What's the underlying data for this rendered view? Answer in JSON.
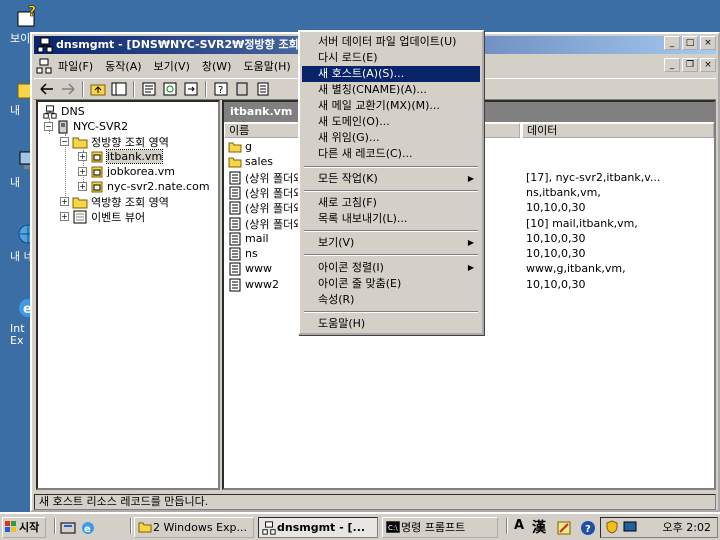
{
  "desktop": {
    "icons": [
      {
        "label": "보이"
      },
      {
        "label": "내"
      },
      {
        "label": "내"
      },
      {
        "label": "내 네"
      },
      {
        "label": "Int"
      },
      {
        "label": "Ex"
      }
    ]
  },
  "window": {
    "title": "dnsmgmt - [DNS₩NYC-SVR2₩정방향 조회",
    "menu": [
      "파일(F)",
      "동작(A)",
      "보기(V)",
      "창(W)",
      "도움말(H)"
    ]
  },
  "tree": {
    "root": "DNS",
    "server": "NYC-SVR2",
    "forward_zone": "정방향 조회 영역",
    "zones": [
      "itbank.vm",
      "jobkorea.vm",
      "nyc-svr2.nate.com"
    ],
    "reverse_zone": "역방향 조회 영역",
    "event_viewer": "이벤트 뷰어"
  },
  "details": {
    "zone_title": "itbank.vm",
    "col_name": "이름",
    "col_data": "데이터",
    "rows": [
      {
        "name": "g",
        "data": ""
      },
      {
        "name": "sales",
        "data": ""
      },
      {
        "name": "(상위 폴더와",
        "data": "[17], nyc-svr2,itbank,v..."
      },
      {
        "name": "(상위 폴더와",
        "data": "ns,itbank,vm,"
      },
      {
        "name": "(상위 폴더와",
        "data": "10,10,0,30"
      },
      {
        "name": "(상위 폴더와",
        "data": "[10]  mail,itbank,vm,"
      },
      {
        "name": "mail",
        "data": "10,10,0,30"
      },
      {
        "name": "ns",
        "data": "10,10,0,30"
      },
      {
        "name": "www",
        "data": "www,g,itbank,vm,"
      },
      {
        "name": "www2",
        "data": "10,10,0,30"
      }
    ]
  },
  "status": "새 호스트 리소스 레코드를 만듭니다.",
  "context_menu": {
    "items": [
      {
        "label": "서버 데이터 파일 업데이트(U)"
      },
      {
        "label": "다시 로드(E)"
      },
      {
        "label": "새 호스트(A)(S)..."
      },
      {
        "label": "새 별칭(CNAME)(A)..."
      },
      {
        "label": "새 메일 교환기(MX)(M)..."
      },
      {
        "label": "새 도메인(O)..."
      },
      {
        "label": "새 위임(G)..."
      },
      {
        "label": "다른 새 레코드(C)..."
      },
      {
        "label": "모든 작업(K)"
      },
      {
        "label": "새로 고침(F)"
      },
      {
        "label": "목록 내보내기(L)..."
      },
      {
        "label": "보기(V)"
      },
      {
        "label": "아이콘 정렬(I)"
      },
      {
        "label": "아이콘 줄 맞춤(E)"
      },
      {
        "label": "속성(R)"
      },
      {
        "label": "도움말(H)"
      }
    ],
    "highlighted_index": 2
  },
  "taskbar": {
    "start": "시작",
    "tasks": [
      "2 Windows Exp...",
      "dnsmgmt - [...",
      "명령 프롬프트"
    ],
    "tray_lang": "A",
    "tray_ime": "漢",
    "clock": "오후 2:02"
  },
  "colors": {
    "desktop": "#3a6ea5",
    "title_active": "#0a246a",
    "menu_highlight": "#0a246a",
    "face": "#d4d0c8"
  }
}
